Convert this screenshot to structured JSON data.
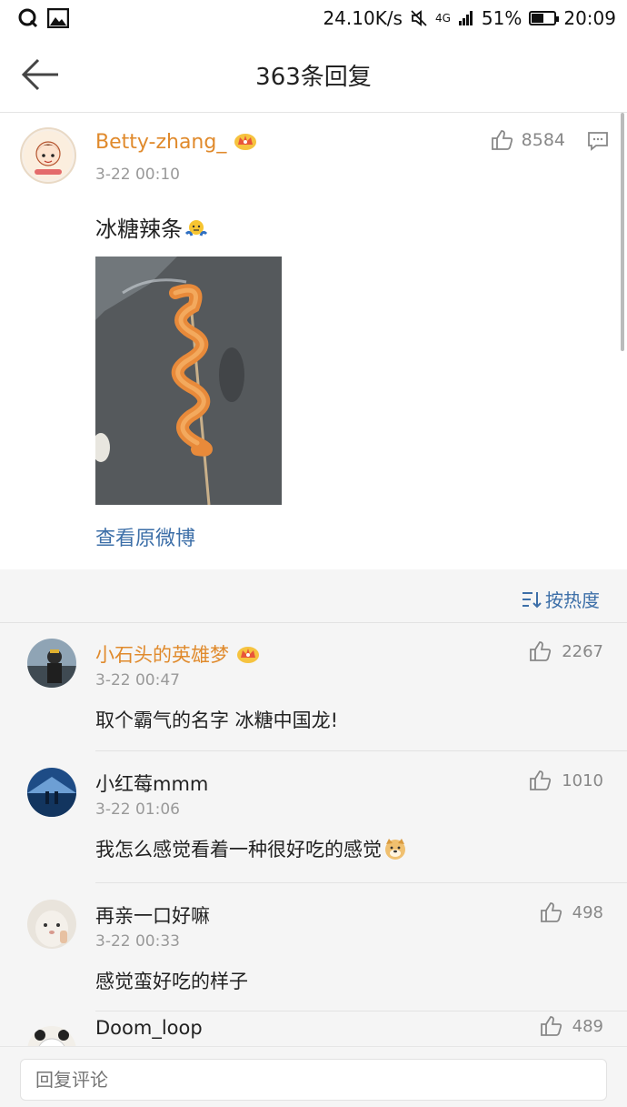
{
  "status_bar": {
    "speed": "24.10K/s",
    "network": "4G",
    "battery": "51%",
    "time": "20:09"
  },
  "header": {
    "title": "363条回复"
  },
  "post": {
    "author": "Betty-zhang_",
    "time": "3-22 00:10",
    "likes": "8584",
    "text": "冰糖辣条",
    "view_original": "查看原微博"
  },
  "sort": {
    "label": "按热度"
  },
  "comments": [
    {
      "name": "小石头的英雄梦",
      "time": "3-22 00:47",
      "text": "取个霸气的名字 冰糖中国龙!",
      "likes": "2267",
      "vip": true
    },
    {
      "name": "小红莓mmm",
      "time": "3-22 01:06",
      "text": "我怎么感觉看着一种很好吃的感觉",
      "likes": "1010",
      "vip": false
    },
    {
      "name": "再亲一口好嘛",
      "time": "3-22 00:33",
      "text": "感觉蛮好吃的样子",
      "likes": "498",
      "vip": false
    },
    {
      "name": "Doom_loop",
      "likes": "489",
      "vip": false
    }
  ],
  "reply": {
    "placeholder": "回复评论"
  },
  "colors": {
    "name_vip": "#e08a2c",
    "link": "#3d6fa8",
    "meta": "#999999"
  }
}
